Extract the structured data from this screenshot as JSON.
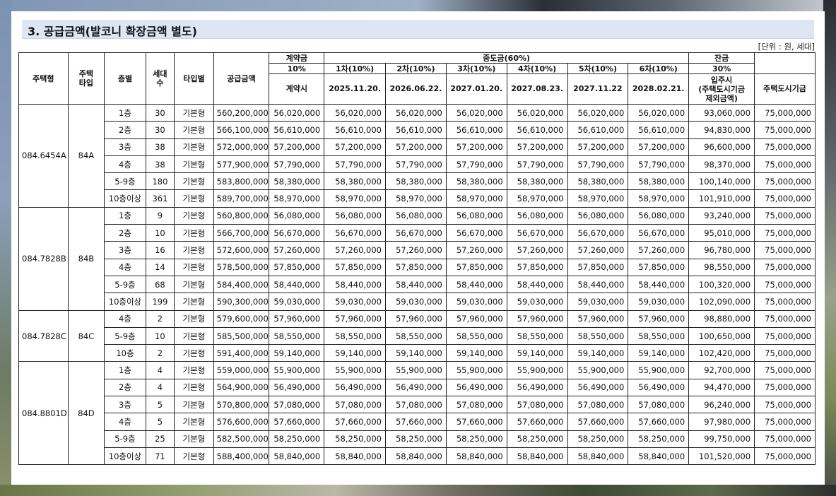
{
  "title": "3. 공급금액(발코니 확장금액 별도)",
  "unit": "[단위 : 원, 세대]",
  "header": {
    "housing_type": "주택형",
    "housing_type2_line1": "주택",
    "housing_type2_line2": "타입",
    "floor": "층별",
    "households_line1": "세대",
    "households_line2": "수",
    "type": "타입별",
    "supply_price": "공급금액",
    "contract": "계약금",
    "contract_pct": "10%",
    "contract_when": "계약시",
    "middle": "중도금(60%)",
    "installments": [
      {
        "label": "1차(10%)",
        "date": "2025.11.20."
      },
      {
        "label": "2차(10%)",
        "date": "2026.06.22."
      },
      {
        "label": "3차(10%)",
        "date": "2027.01.20."
      },
      {
        "label": "4차(10%)",
        "date": "2027.08.23."
      },
      {
        "label": "5차(10%)",
        "date": "2027.11.22"
      },
      {
        "label": "6차(10%)",
        "date": "2028.02.21."
      }
    ],
    "balance": "잔금",
    "balance_pct": "30%",
    "move_in_line1": "입주시",
    "move_in_line2": "(주택도시기금",
    "move_in_line3": "제외금액)",
    "fund": "주택도시기금"
  },
  "groups": [
    {
      "code": "084.6454A",
      "type": "84A",
      "rows": [
        {
          "floor": "1층",
          "units": "30",
          "kind": "기본형",
          "price": "560,200,000",
          "contract": "56,020,000",
          "mid": "56,020,000",
          "balance": "93,060,000",
          "fund": "75,000,000"
        },
        {
          "floor": "2층",
          "units": "30",
          "kind": "기본형",
          "price": "566,100,000",
          "contract": "56,610,000",
          "mid": "56,610,000",
          "balance": "94,830,000",
          "fund": "75,000,000"
        },
        {
          "floor": "3층",
          "units": "38",
          "kind": "기본형",
          "price": "572,000,000",
          "contract": "57,200,000",
          "mid": "57,200,000",
          "balance": "96,600,000",
          "fund": "75,000,000"
        },
        {
          "floor": "4층",
          "units": "38",
          "kind": "기본형",
          "price": "577,900,000",
          "contract": "57,790,000",
          "mid": "57,790,000",
          "balance": "98,370,000",
          "fund": "75,000,000"
        },
        {
          "floor": "5-9층",
          "units": "180",
          "kind": "기본형",
          "price": "583,800,000",
          "contract": "58,380,000",
          "mid": "58,380,000",
          "balance": "100,140,000",
          "fund": "75,000,000"
        },
        {
          "floor": "10층이상",
          "units": "361",
          "kind": "기본형",
          "price": "589,700,000",
          "contract": "58,970,000",
          "mid": "58,970,000",
          "balance": "101,910,000",
          "fund": "75,000,000"
        }
      ]
    },
    {
      "code": "084.7828B",
      "type": "84B",
      "rows": [
        {
          "floor": "1층",
          "units": "9",
          "kind": "기본형",
          "price": "560,800,000",
          "contract": "56,080,000",
          "mid": "56,080,000",
          "balance": "93,240,000",
          "fund": "75,000,000"
        },
        {
          "floor": "2층",
          "units": "10",
          "kind": "기본형",
          "price": "566,700,000",
          "contract": "56,670,000",
          "mid": "56,670,000",
          "balance": "95,010,000",
          "fund": "75,000,000"
        },
        {
          "floor": "3층",
          "units": "16",
          "kind": "기본형",
          "price": "572,600,000",
          "contract": "57,260,000",
          "mid": "57,260,000",
          "balance": "96,780,000",
          "fund": "75,000,000"
        },
        {
          "floor": "4층",
          "units": "14",
          "kind": "기본형",
          "price": "578,500,000",
          "contract": "57,850,000",
          "mid": "57,850,000",
          "balance": "98,550,000",
          "fund": "75,000,000"
        },
        {
          "floor": "5-9층",
          "units": "68",
          "kind": "기본형",
          "price": "584,400,000",
          "contract": "58,440,000",
          "mid": "58,440,000",
          "balance": "100,320,000",
          "fund": "75,000,000"
        },
        {
          "floor": "10층이상",
          "units": "199",
          "kind": "기본형",
          "price": "590,300,000",
          "contract": "59,030,000",
          "mid": "59,030,000",
          "balance": "102,090,000",
          "fund": "75,000,000"
        }
      ]
    },
    {
      "code": "084.7828C",
      "type": "84C",
      "rows": [
        {
          "floor": "4층",
          "units": "2",
          "kind": "기본형",
          "price": "579,600,000",
          "contract": "57,960,000",
          "mid": "57,960,000",
          "balance": "98,880,000",
          "fund": "75,000,000"
        },
        {
          "floor": "5-9층",
          "units": "10",
          "kind": "기본형",
          "price": "585,500,000",
          "contract": "58,550,000",
          "mid": "58,550,000",
          "balance": "100,650,000",
          "fund": "75,000,000"
        },
        {
          "floor": "10층",
          "units": "2",
          "kind": "기본형",
          "price": "591,400,000",
          "contract": "59,140,000",
          "mid": "59,140,000",
          "balance": "102,420,000",
          "fund": "75,000,000"
        }
      ]
    },
    {
      "code": "084.8801D",
      "type": "84D",
      "rows": [
        {
          "floor": "1층",
          "units": "4",
          "kind": "기본형",
          "price": "559,000,000",
          "contract": "55,900,000",
          "mid": "55,900,000",
          "balance": "92,700,000",
          "fund": "75,000,000"
        },
        {
          "floor": "2층",
          "units": "4",
          "kind": "기본형",
          "price": "564,900,000",
          "contract": "56,490,000",
          "mid": "56,490,000",
          "balance": "94,470,000",
          "fund": "75,000,000"
        },
        {
          "floor": "3층",
          "units": "5",
          "kind": "기본형",
          "price": "570,800,000",
          "contract": "57,080,000",
          "mid": "57,080,000",
          "balance": "96,240,000",
          "fund": "75,000,000"
        },
        {
          "floor": "4층",
          "units": "5",
          "kind": "기본형",
          "price": "576,600,000",
          "contract": "57,660,000",
          "mid": "57,660,000",
          "balance": "97,980,000",
          "fund": "75,000,000"
        },
        {
          "floor": "5-9층",
          "units": "25",
          "kind": "기본형",
          "price": "582,500,000",
          "contract": "58,250,000",
          "mid": "58,250,000",
          "balance": "99,750,000",
          "fund": "75,000,000"
        },
        {
          "floor": "10층이상",
          "units": "71",
          "kind": "기본형",
          "price": "588,400,000",
          "contract": "58,840,000",
          "mid": "58,840,000",
          "balance": "101,520,000",
          "fund": "75,000,000"
        }
      ]
    }
  ]
}
